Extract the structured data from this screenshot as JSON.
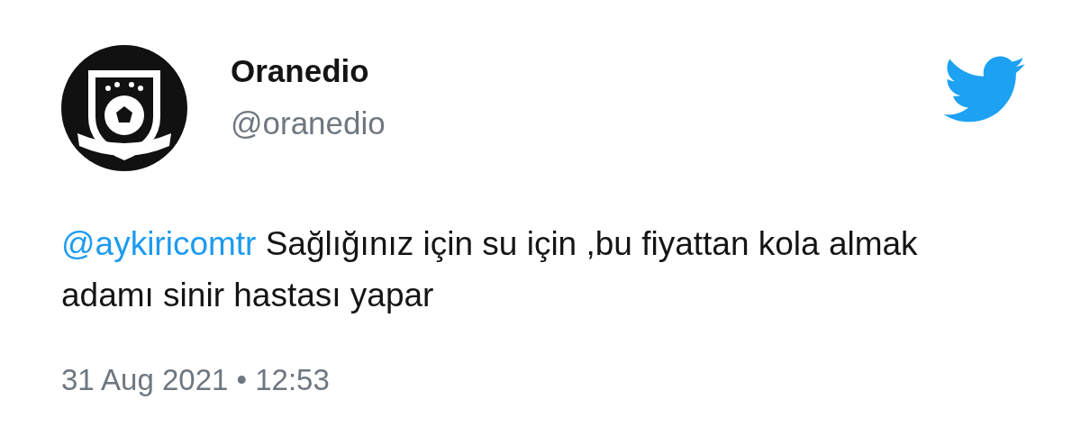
{
  "author": {
    "name": "Oranedio",
    "handle": "@oranedio"
  },
  "tweet": {
    "mention": "@aykiricomtr",
    "text": "Sağlığınız için su için ,bu fiyattan kola almak adamı sinir hastası yapar"
  },
  "timestamp": {
    "date": "31 Aug 2021",
    "separator": "•",
    "time": "12:53"
  }
}
